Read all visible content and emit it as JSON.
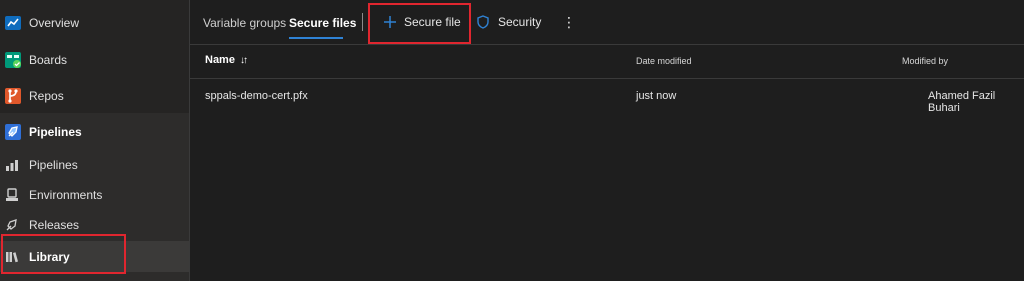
{
  "sidebar": {
    "items": [
      {
        "label": "Overview",
        "icon": "overview-icon"
      },
      {
        "label": "Boards",
        "icon": "boards-icon"
      },
      {
        "label": "Repos",
        "icon": "repos-icon"
      }
    ],
    "section": {
      "label": "Pipelines",
      "icon": "pipelines-rocket-icon"
    },
    "sub_items": [
      {
        "label": "Pipelines",
        "icon": "pipelines-icon"
      },
      {
        "label": "Environments",
        "icon": "environments-icon"
      },
      {
        "label": "Releases",
        "icon": "releases-icon"
      },
      {
        "label": "Library",
        "icon": "library-icon"
      }
    ]
  },
  "tabs": [
    {
      "label": "Variable groups"
    },
    {
      "label": "Secure files"
    }
  ],
  "commands": {
    "secure_file_label": "Secure file",
    "security_label": "Security",
    "more_symbol": "⋮"
  },
  "table": {
    "columns": [
      {
        "label": "Name",
        "sort_symbol": "↓↑"
      },
      {
        "label": "Date modified"
      },
      {
        "label": "Modified by"
      }
    ],
    "rows": [
      {
        "name": "sppals-demo-cert.pfx",
        "date_modified": "just now",
        "modified_by": "Ahamed Fazil Buhari"
      }
    ]
  },
  "colors": {
    "accent": "#2f82d4",
    "highlight_box": "#e0262f",
    "background": "#1e1e1e",
    "sidebar": "#252423"
  }
}
